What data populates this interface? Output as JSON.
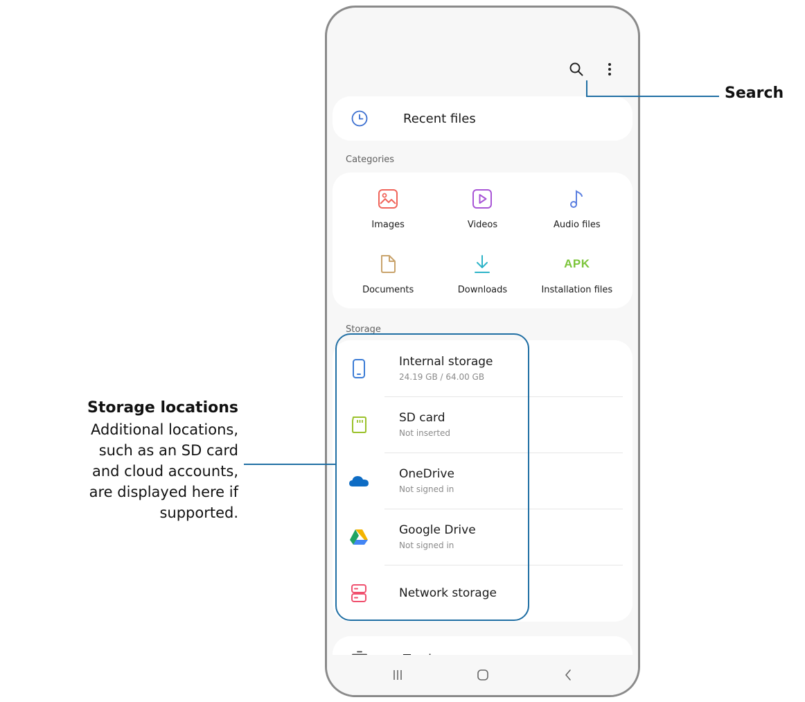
{
  "toolbar": {
    "search_icon": "search-icon",
    "more_icon": "more-vert-icon"
  },
  "recent": {
    "label": "Recent files",
    "icon": "clock-icon"
  },
  "categories": {
    "title": "Categories",
    "items": [
      {
        "label": "Images",
        "icon": "image-icon",
        "color": "#f0645a"
      },
      {
        "label": "Videos",
        "icon": "video-icon",
        "color": "#a855d6"
      },
      {
        "label": "Audio files",
        "icon": "music-note-icon",
        "color": "#5b7fe0"
      },
      {
        "label": "Documents",
        "icon": "document-icon",
        "color": "#c9a36b"
      },
      {
        "label": "Downloads",
        "icon": "download-icon",
        "color": "#2bb3c7"
      },
      {
        "label": "Installation files",
        "icon": "apk-icon",
        "badge": "APK",
        "color": "#7cc53b"
      }
    ]
  },
  "storage": {
    "title": "Storage",
    "items": [
      {
        "name": "Internal storage",
        "sub": "24.19 GB / 64.00 GB",
        "icon": "phone-icon",
        "color": "#3a7bd5"
      },
      {
        "name": "SD card",
        "sub": "Not inserted",
        "icon": "sd-card-icon",
        "color": "#9ac12a"
      },
      {
        "name": "OneDrive",
        "sub": "Not signed in",
        "icon": "onedrive-icon",
        "color": "#0e6cc4"
      },
      {
        "name": "Google Drive",
        "sub": "Not signed in",
        "icon": "google-drive-icon",
        "color": "#1fa463"
      },
      {
        "name": "Network storage",
        "sub": "",
        "icon": "server-icon",
        "color": "#f0506e"
      }
    ]
  },
  "trash": {
    "label": "Trash",
    "icon": "trash-icon"
  },
  "navbar": {
    "recents_icon": "recents-icon",
    "home_icon": "home-icon",
    "back_icon": "back-icon"
  },
  "annotations": {
    "search": "Search",
    "storage_title": "Storage locations",
    "storage_lines": [
      "Additional locations,",
      "such as an SD card",
      "and cloud accounts,",
      "are displayed here if",
      "supported."
    ],
    "line_color": "#1f6ea3"
  }
}
